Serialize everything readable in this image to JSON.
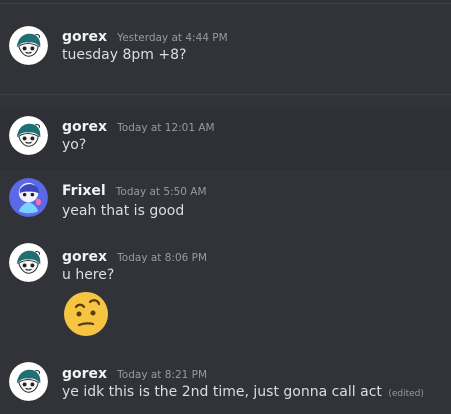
{
  "messages": [
    {
      "author": "gorex",
      "timestamp": "Yesterday at 4:44 PM",
      "content": "tuesday 8pm +8?",
      "avatar": "gorex-avatar"
    },
    {
      "author": "gorex",
      "timestamp": "Today at 12:01 AM",
      "content": "yo?",
      "avatar": "gorex-avatar"
    },
    {
      "author": "Frixel",
      "timestamp": "Today at 5:50 AM",
      "content": "yeah that is good",
      "avatar": "frixel-avatar"
    },
    {
      "author": "gorex",
      "timestamp": "Today at 8:06 PM",
      "content": "u here?",
      "emoji": "face-with-raised-eyebrow-emoji",
      "avatar": "gorex-avatar"
    },
    {
      "author": "gorex",
      "timestamp": "Today at 8:21 PM",
      "content": "ye idk this is the 2nd time, just gonna call act",
      "edited": "(edited)",
      "avatar": "gorex-avatar"
    }
  ],
  "colors": {
    "background": "#313338",
    "author": "#f2f3f5",
    "text": "#dbdee1",
    "muted": "#949ba4",
    "emoji": "#f5c542"
  }
}
